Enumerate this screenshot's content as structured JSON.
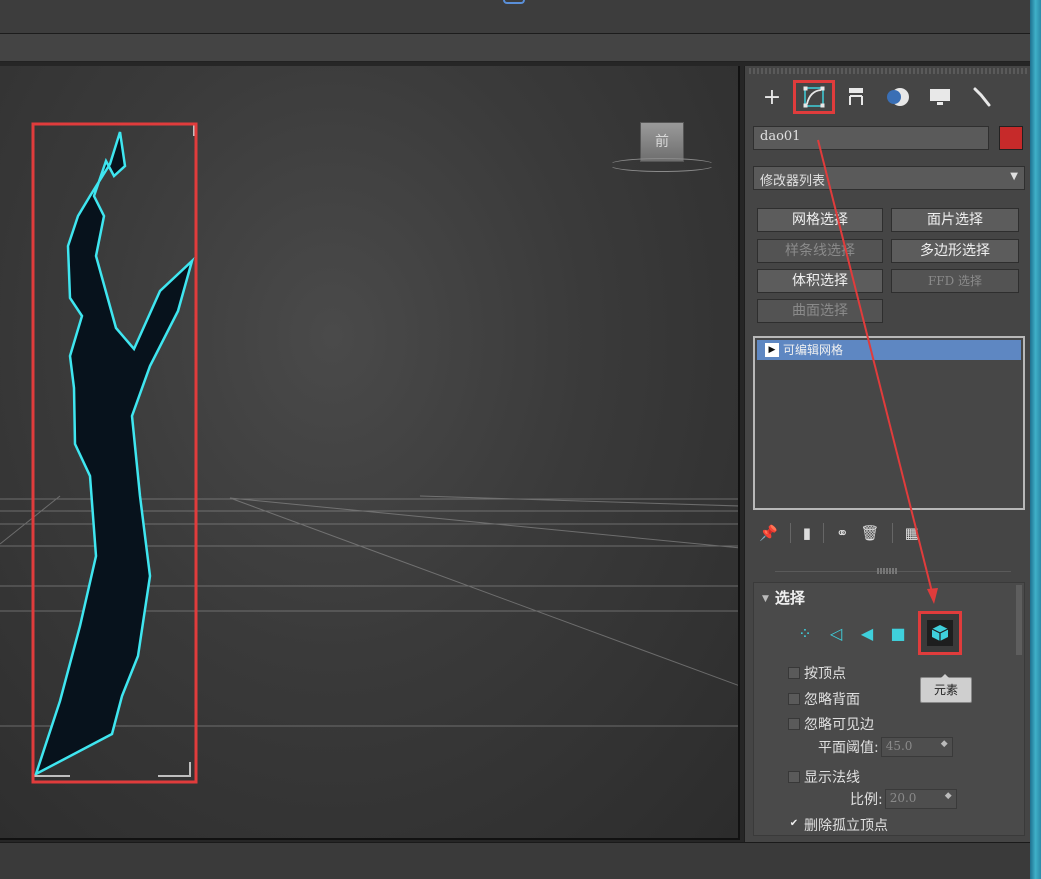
{
  "object": {
    "name": "dao01",
    "color": "#c62a2a"
  },
  "viewcube": {
    "label": "前"
  },
  "command_tabs": [
    {
      "id": "create",
      "icon": "plus-icon"
    },
    {
      "id": "modify",
      "icon": "modify-curve-icon"
    },
    {
      "id": "hierarchy",
      "icon": "hierarchy-icon"
    },
    {
      "id": "motion",
      "icon": "motion-icon"
    },
    {
      "id": "display",
      "icon": "display-monitor-icon"
    },
    {
      "id": "utilities",
      "icon": "wrench-icon"
    }
  ],
  "modifier_list": {
    "label": "修改器列表"
  },
  "modifier_buttons": {
    "mesh_select": "网格选择",
    "patch_select": "面片选择",
    "spline_select": "样条线选择",
    "poly_select": "多边形选择",
    "volume_select": "体积选择",
    "ffd_select": "FFD 选择",
    "surface_select": "曲面选择"
  },
  "stack": {
    "item": "可编辑网格"
  },
  "selection_rollout": {
    "title": "选择",
    "tooltip": "元素",
    "by_vertex": "按顶点",
    "ignore_backfacing": "忽略背面",
    "ignore_visible_edges": "忽略可见边",
    "planar_thresh_label": "平面阈值:",
    "planar_thresh_value": "45.0",
    "show_normals": "显示法线",
    "scale_label": "比例:",
    "scale_value": "20.0",
    "delete_isolated": "删除孤立顶点"
  },
  "colors": {
    "highlight": "#e03c3c",
    "mesh_outline": "#3fe6f0",
    "accent": "#5e87c2"
  }
}
